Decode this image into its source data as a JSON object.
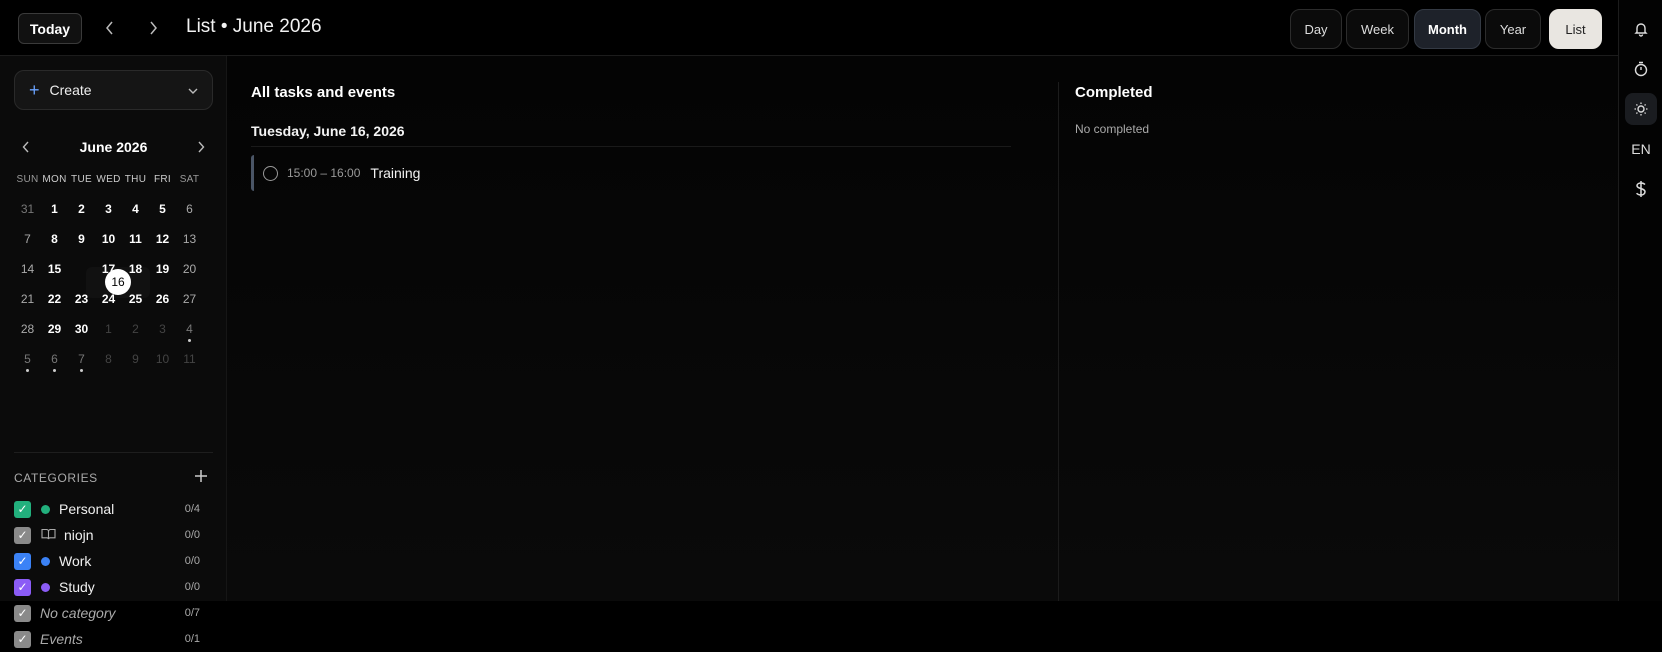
{
  "header": {
    "today_label": "Today",
    "title": "List • June 2026",
    "views": [
      {
        "label": "Day"
      },
      {
        "label": "Week"
      },
      {
        "label": "Month"
      },
      {
        "label": "Year"
      },
      {
        "label": "List"
      }
    ]
  },
  "sidebar": {
    "create_label": "Create",
    "calendar": {
      "month_title": "June 2026",
      "weekdays": [
        "SUN",
        "MON",
        "TUE",
        "WED",
        "THU",
        "FRI",
        "SAT"
      ],
      "weeks": [
        [
          "31",
          "1",
          "2",
          "3",
          "4",
          "5",
          "6"
        ],
        [
          "7",
          "8",
          "9",
          "10",
          "11",
          "12",
          "13"
        ],
        [
          "14",
          "15",
          "16",
          "17",
          "18",
          "19",
          "20"
        ],
        [
          "21",
          "22",
          "23",
          "24",
          "25",
          "26",
          "27"
        ],
        [
          "28",
          "29",
          "30",
          "1",
          "2",
          "3",
          "4"
        ],
        [
          "5",
          "6",
          "7",
          "8",
          "9",
          "10",
          "11"
        ]
      ],
      "selected_day": "16"
    },
    "categories_title": "CATEGORIES",
    "categories": [
      {
        "name": "Personal",
        "count": "0/4",
        "color": "#22b07d"
      },
      {
        "name": "niojn",
        "count": "0/0",
        "color": "#888888",
        "icon": "book-icon"
      },
      {
        "name": "Work",
        "count": "0/0",
        "color": "#3b82f6"
      },
      {
        "name": "Study",
        "count": "0/0",
        "color": "#8b5cf6"
      },
      {
        "name": "No category",
        "count": "0/7",
        "color": "#888888"
      },
      {
        "name": "Events",
        "count": "0/1",
        "color": "#888888"
      }
    ]
  },
  "main": {
    "list_title": "All tasks and events",
    "date_heading": "Tuesday, June 16, 2026",
    "tasks": [
      {
        "time": "15:00 – 16:00",
        "name": "Training"
      }
    ],
    "completed_title": "Completed",
    "completed_empty": "No completed"
  },
  "right_rail": {
    "language": "EN",
    "icons": [
      "bell-icon",
      "timer-icon",
      "sun-icon",
      "language-toggle",
      "dollar-icon"
    ]
  }
}
